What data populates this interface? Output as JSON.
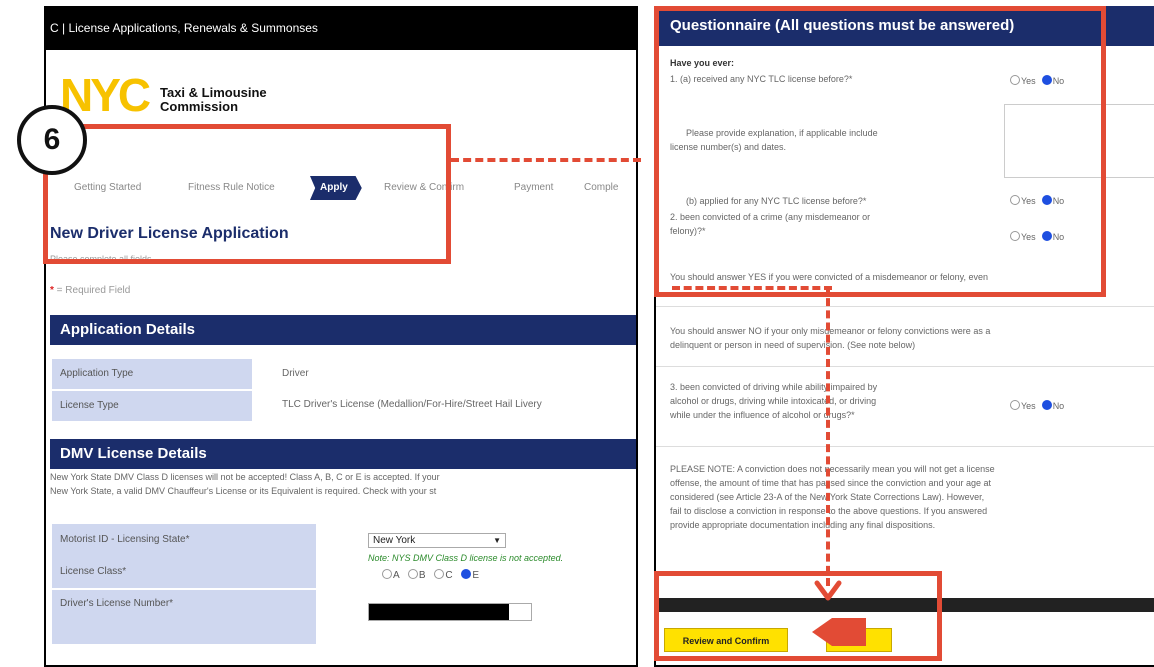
{
  "left": {
    "header": "C | License Applications, Renewals & Summonses",
    "logo_text": "NYC",
    "org_name_line1": "Taxi & Limousine",
    "org_name_line2": "Commission",
    "steps": [
      "Getting Started",
      "Fitness Rule Notice",
      "Apply",
      "Review & Confirm",
      "Payment",
      "Comple"
    ],
    "page_title": "New Driver License Application",
    "page_subtitle": "Please complete all fields.",
    "required_star": "*",
    "required_note": " = Required Field",
    "application_details": {
      "heading": "Application Details",
      "rows": [
        {
          "label": "Application Type",
          "value": "Driver"
        },
        {
          "label": "License Type",
          "value": "TLC Driver's License (Medallion/For-Hire/Street Hail Livery"
        }
      ]
    },
    "dmv": {
      "heading": "DMV License Details",
      "note_line1": "New York State DMV Class D licenses will not be accepted! Class A, B, C or E is accepted. If your",
      "note_line2": "New York State, a valid DMV Chauffeur's License or its Equivalent is required. Check with your st",
      "state_label": "Motorist ID - Licensing State*",
      "state_value": "New York",
      "class_label": "License Class*",
      "class_note": "Note: NYS DMV Class D license is not accepted.",
      "class_options": [
        "A",
        "B",
        "C",
        "E"
      ],
      "class_selected": "E",
      "dl_label": "Driver's License Number*"
    }
  },
  "right": {
    "title": "Questionnaire (All questions must be answered)",
    "have_you_ever": "Have you ever:",
    "q1a": "1. (a) received any NYC TLC license before?*",
    "q1a_explain_1": "Please provide explanation, if applicable   include",
    "q1a_explain_2": "license number(s) and dates.",
    "q1b": "(b) applied for any NYC TLC license before?*",
    "q2_line1": "2. been convicted of a crime (any misdemeanor or",
    "q2_line2": "felony)?*",
    "yes_note": "You should answer YES if you were convicted of a misdemeanor or felony, even",
    "no_note_1": "You should answer NO if your only misdemeanor or felony convictions were as a",
    "no_note_2": "delinquent or person in need of supervision. (See note below)",
    "q3_line1": "3. been convicted of driving while ability impaired by",
    "q3_line2": "alcohol or drugs, driving while intoxicated, or driving",
    "q3_line3": "while under the influence of alcohol or drugs?*",
    "please_note": [
      "PLEASE NOTE: A conviction does not necessarily mean you will not get a license",
      "offense, the amount of time that has passed since the conviction and your age at",
      "considered (see Article 23-A of the New York State Corrections Law). However,",
      "fail to disclose a conviction in response to the above questions. If you answered",
      "provide appropriate documentation including any final dispositions."
    ],
    "yes": "Yes",
    "no": "No",
    "review_button": "Review and Confirm",
    "second_button": "el"
  },
  "annotation": {
    "step_number": "6",
    "color": "#e24b35"
  }
}
